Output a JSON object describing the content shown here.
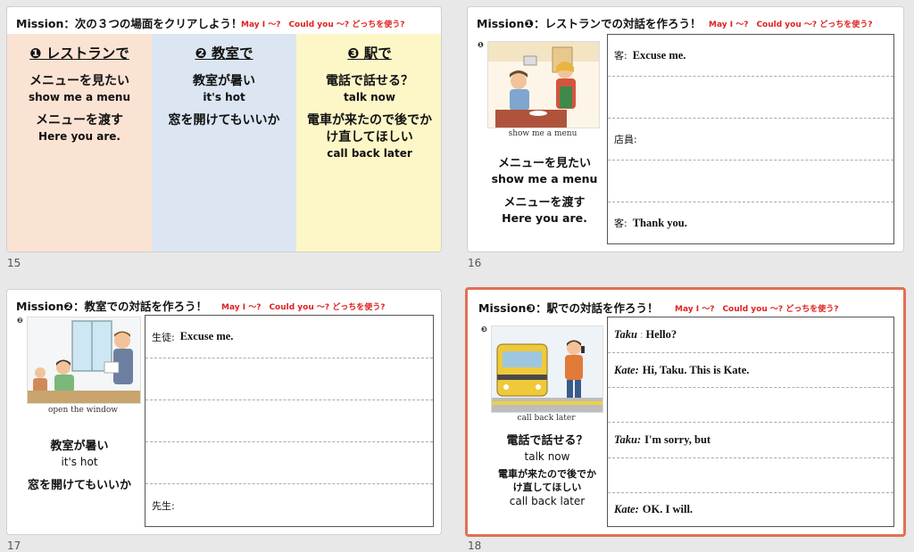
{
  "slides": [
    {
      "number": "15",
      "title": "Mission：次の３つの場面をクリアしよう！",
      "subtitle": "May I ～?　Could  you ～?  どっちを使う?",
      "columns": [
        {
          "heading": "❶ レストランで",
          "lines": [
            {
              "jp": "メニューを見たい",
              "en": "show me a menu"
            },
            {
              "jp": "メニューを渡す",
              "en": "Here you are."
            }
          ]
        },
        {
          "heading": "❷ 教室で",
          "lines": [
            {
              "jp": "教室が暑い",
              "en": "it's hot"
            },
            {
              "jp": "窓を開けてもいいか",
              "en": ""
            }
          ]
        },
        {
          "heading": "❸ 駅で",
          "lines": [
            {
              "jp": "電話で話せる？",
              "en": "talk now"
            },
            {
              "jp": "電車が来たので後でかけ直してほしい",
              "en": "call back later"
            }
          ]
        }
      ]
    },
    {
      "number": "16",
      "title": "Mission❶：レストランでの対話を作ろう！",
      "subtitle": "May I ～?　Could  you ～?  どっちを使う?",
      "marker": "❶",
      "caption": "show me a menu",
      "left_lines": [
        {
          "jp": "メニューを見たい",
          "en": "show me a menu"
        },
        {
          "jp": "メニューを渡す",
          "en": "Here you are."
        }
      ],
      "rows": [
        {
          "label": "客:",
          "text": "Excuse me."
        },
        {
          "label": "",
          "text": ""
        },
        {
          "label": "店員:",
          "text": ""
        },
        {
          "label": "",
          "text": ""
        },
        {
          "label": "客:",
          "text": "Thank you."
        }
      ]
    },
    {
      "number": "17",
      "title": "Mission❷：教室での対話を作ろう！",
      "subtitle": "May I ～?　Could  you ～?  どっちを使う?",
      "marker": "❷",
      "caption": "open the window",
      "left_lines": [
        {
          "jp": "教室が暑い",
          "en": "it's hot"
        },
        {
          "jp": "窓を開けてもいいか",
          "en": ""
        }
      ],
      "rows": [
        {
          "label": "生徒:",
          "text": "Excuse me."
        },
        {
          "label": "",
          "text": ""
        },
        {
          "label": "",
          "text": ""
        },
        {
          "label": "",
          "text": ""
        },
        {
          "label": "先生:",
          "text": ""
        }
      ]
    },
    {
      "number": "18",
      "title": "Mission❸：駅での対話を作ろう！",
      "subtitle": "May I ～?　Could  you ～?  どっちを使う?",
      "marker": "❸",
      "caption": "call back later",
      "left_lines": [
        {
          "jp": "電話で話せる？",
          "en": "talk now"
        },
        {
          "jp": "電車が来たので後でかけ直してほしい",
          "en": "call back later"
        }
      ],
      "rows": [
        {
          "speaker": "Taku",
          "sep": ":",
          "text": "Hello?"
        },
        {
          "speaker": "Kate:",
          "sep": "",
          "text": "Hi, Taku.  This is Kate."
        },
        {
          "speaker": "",
          "sep": "",
          "text": ""
        },
        {
          "speaker": "Taku:",
          "sep": "",
          "text": "I'm sorry, but"
        },
        {
          "speaker": "",
          "sep": "",
          "text": ""
        },
        {
          "speaker": "Kate:",
          "sep": "",
          "text": "OK.  I will."
        }
      ]
    }
  ],
  "colors": {
    "col1_bg": "#fbe3d4",
    "col2_bg": "#dbe6f2",
    "col3_bg": "#fdf7c7",
    "subtitle_red": "#e02020",
    "selection_border": "#e07055"
  }
}
